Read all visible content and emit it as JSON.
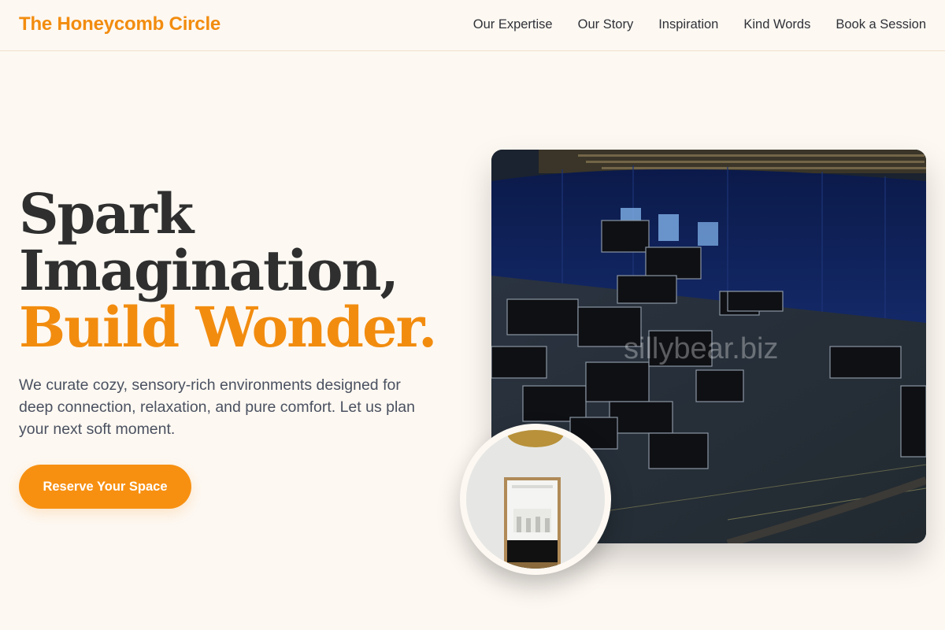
{
  "header": {
    "brand": "The Honeycomb Circle",
    "nav": [
      "Our Expertise",
      "Our Story",
      "Inspiration",
      "Kind Words",
      "Book a Session"
    ]
  },
  "hero": {
    "title_line1": "Spark",
    "title_line2": "Imagination,",
    "title_line3": "Build Wonder.",
    "subtitle": "We curate cozy, sensory-rich environments designed for deep connection, relaxation, and pure comfort. Let us plan your next soft moment.",
    "cta": "Reserve Your Space"
  },
  "images": {
    "main_watermark": "sillybear.biz"
  },
  "colors": {
    "accent": "#f28c0f",
    "background": "#fdf8f2",
    "heading": "#2f2f2f",
    "body_text": "#4a5160"
  }
}
